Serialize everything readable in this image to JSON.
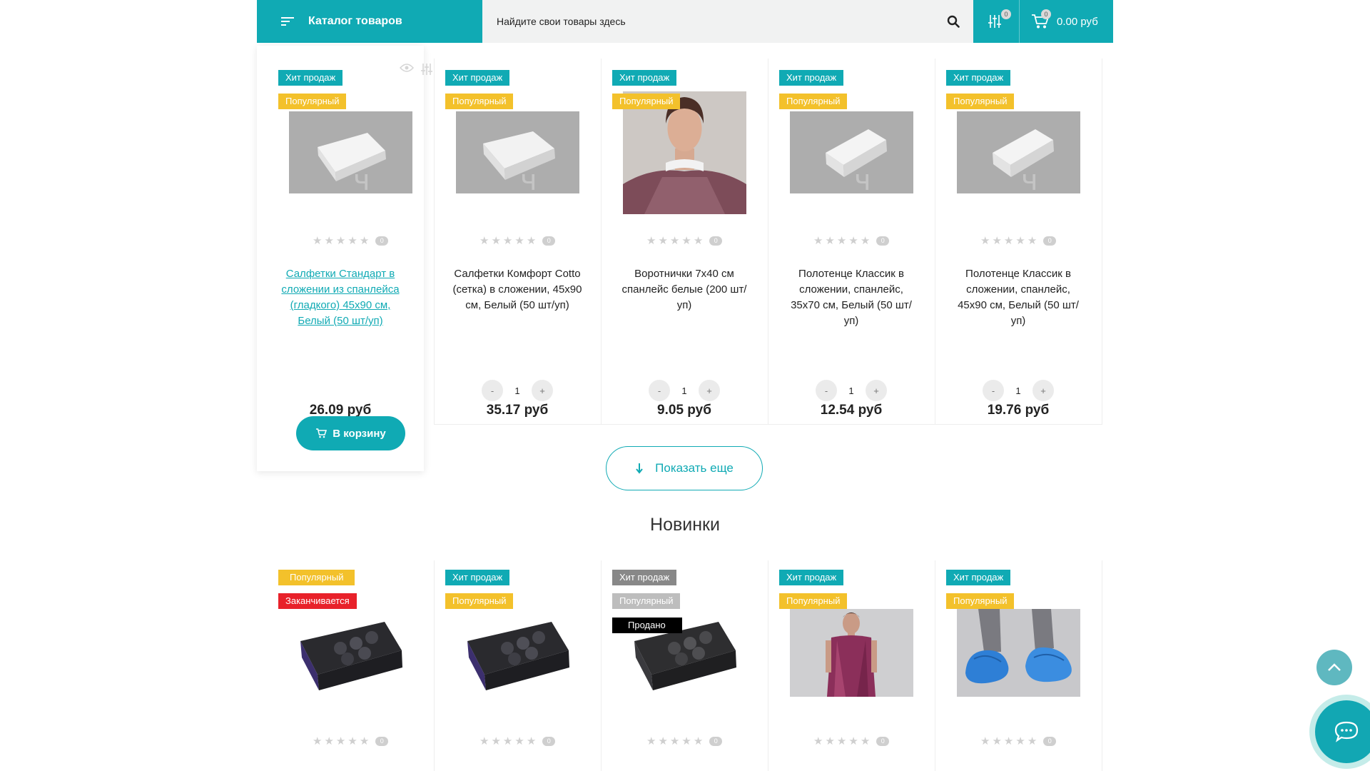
{
  "header": {
    "catalog_label": "Каталог товаров",
    "search_placeholder": "Найдите свои товары здесь",
    "compare_count": "0",
    "cart_count": "0",
    "cart_total": "0.00 руб"
  },
  "bestsellers": {
    "products": [
      {
        "labels": [
          "Хит продаж",
          "Популярный"
        ],
        "reviews": "0",
        "name": "Салфетки Стандарт в сложении из спанлейса (гладкого) 45х90 см, Белый (50 шт/уп)",
        "price": "26.09 руб",
        "qty": "1",
        "qty_minus": "-",
        "qty_plus": "+",
        "cart_label": "В корзину"
      },
      {
        "labels": [
          "Хит продаж",
          "Популярный"
        ],
        "reviews": "0",
        "name": "Салфетки Комфорт Cotto (сетка) в сложении, 45х90 см, Белый (50 шт/уп)",
        "price": "35.17 руб",
        "qty": "1",
        "qty_minus": "-",
        "qty_plus": "+"
      },
      {
        "labels": [
          "Хит продаж",
          "Популярный"
        ],
        "reviews": "0",
        "name": "Воротнички 7х40 см спанлейс белые (200 шт/уп)",
        "price": "9.05 руб",
        "qty": "1",
        "qty_minus": "-",
        "qty_plus": "+"
      },
      {
        "labels": [
          "Хит продаж",
          "Популярный"
        ],
        "reviews": "0",
        "name": "Полотенце Классик в сложении, спанлейс, 35х70 см, Белый (50 шт/уп)",
        "price": "12.54 руб",
        "qty": "1",
        "qty_minus": "-",
        "qty_plus": "+"
      },
      {
        "labels": [
          "Хит продаж",
          "Популярный"
        ],
        "reviews": "0",
        "name": "Полотенце Классик в сложении, спанлейс, 45х90 см, Белый (50 шт/уп)",
        "price": "19.76 руб",
        "qty": "1",
        "qty_minus": "-",
        "qty_plus": "+"
      }
    ],
    "show_more_label": "Показать еще"
  },
  "new_section": {
    "title": "Новинки",
    "products": [
      {
        "labels": [
          "Популярный",
          "Заканчивается"
        ],
        "reviews": "0"
      },
      {
        "labels": [
          "Хит продаж",
          "Популярный"
        ],
        "reviews": "0"
      },
      {
        "labels": [
          "Хит продаж",
          "Популярный",
          "Продано"
        ],
        "reviews": "0"
      },
      {
        "labels": [
          "Хит продаж",
          "Популярный"
        ],
        "reviews": "0"
      },
      {
        "labels": [
          "Хит продаж",
          "Популярный"
        ],
        "reviews": "0"
      }
    ]
  },
  "colors": {
    "accent": "#10aab4",
    "badge_hit": "#10aab4",
    "badge_popular": "#f3c12b",
    "badge_ending": "#e8212a",
    "badge_sold": "#000000"
  },
  "icons": [
    "menu-icon",
    "search-icon",
    "compare-icon",
    "cart-icon",
    "eye-icon",
    "arrow-down-icon",
    "chevron-up-icon",
    "chat-icon"
  ]
}
